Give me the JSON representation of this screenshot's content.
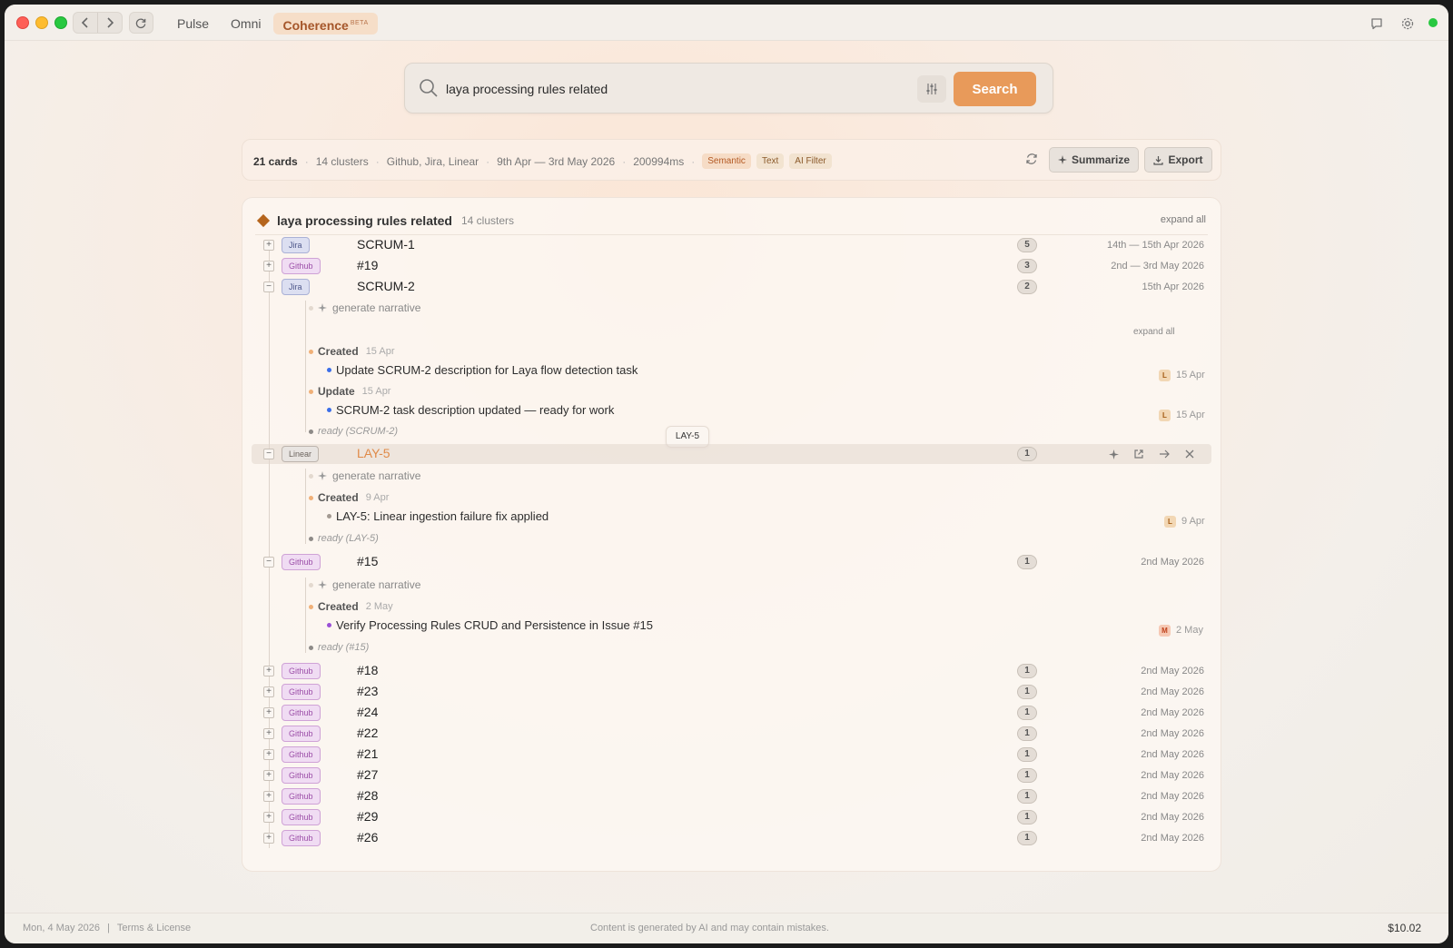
{
  "titlebar": {
    "tabs": [
      {
        "label": "Pulse"
      },
      {
        "label": "Omni"
      },
      {
        "label": "Coherence",
        "badge": "BETA"
      }
    ]
  },
  "search": {
    "value": "laya processing rules related",
    "button_label": "Search"
  },
  "summary": {
    "cards": "21 cards",
    "clusters": "14 clusters",
    "sources": "Github, Jira, Linear",
    "date_range": "9th Apr — 3rd May 2026",
    "duration": "200994ms",
    "modes": [
      "Semantic",
      "Text",
      "AI Filter"
    ],
    "summarize_label": "Summarize",
    "export_label": "Export"
  },
  "results": {
    "query": "laya processing rules related",
    "cluster_count": "14 clusters",
    "expand_all": "expand all",
    "clusters": [
      {
        "source": "Jira",
        "title": "SCRUM-1",
        "count": "5",
        "date": "14th — 15th Apr 2026"
      },
      {
        "source": "Github",
        "title": "#19",
        "count": "3",
        "date": "2nd — 3rd May 2026"
      },
      {
        "source": "Jira",
        "title": "SCRUM-2",
        "count": "2",
        "date": "15th Apr 2026"
      },
      {
        "source": "Linear",
        "title": "LAY-5",
        "count": "1",
        "date": ""
      },
      {
        "source": "Github",
        "title": "#15",
        "count": "1",
        "date": "2nd May 2026"
      },
      {
        "source": "Github",
        "title": "#18",
        "count": "1",
        "date": "2nd May 2026"
      },
      {
        "source": "Github",
        "title": "#23",
        "count": "1",
        "date": "2nd May 2026"
      },
      {
        "source": "Github",
        "title": "#24",
        "count": "1",
        "date": "2nd May 2026"
      },
      {
        "source": "Github",
        "title": "#22",
        "count": "1",
        "date": "2nd May 2026"
      },
      {
        "source": "Github",
        "title": "#21",
        "count": "1",
        "date": "2nd May 2026"
      },
      {
        "source": "Github",
        "title": "#27",
        "count": "1",
        "date": "2nd May 2026"
      },
      {
        "source": "Github",
        "title": "#28",
        "count": "1",
        "date": "2nd May 2026"
      },
      {
        "source": "Github",
        "title": "#29",
        "count": "1",
        "date": "2nd May 2026"
      },
      {
        "source": "Github",
        "title": "#26",
        "count": "1",
        "date": "2nd May 2026"
      }
    ],
    "generate_narrative": "generate narrative",
    "scrum2": {
      "expand_all": "expand all",
      "events": [
        {
          "label": "Created",
          "date": "15 Apr",
          "item": "Update SCRUM-2 description for Laya flow detection task",
          "avatar": "L",
          "item_date": "15 Apr"
        },
        {
          "label": "Update",
          "date": "15 Apr",
          "item": "SCRUM-2 task description updated — ready for work",
          "avatar": "L",
          "item_date": "15 Apr"
        }
      ],
      "ready": "ready (SCRUM-2)"
    },
    "lay5": {
      "tooltip": "LAY-5",
      "events": [
        {
          "label": "Created",
          "date": "9 Apr",
          "item": "LAY-5: Linear ingestion failure fix applied",
          "avatar": "L",
          "item_date": "9 Apr"
        }
      ],
      "ready": "ready (LAY-5)"
    },
    "gh15": {
      "events": [
        {
          "label": "Created",
          "date": "2 May",
          "item": "Verify Processing Rules CRUD and Persistence in Issue #15",
          "avatar": "M",
          "item_date": "2 May"
        }
      ],
      "ready": "ready (#15)"
    }
  },
  "footer": {
    "date": "Mon, 4 May 2026",
    "separator": "|",
    "terms": "Terms & License",
    "disclaimer": "Content is generated by AI and may contain mistakes.",
    "balance": "$10.02"
  },
  "colors": {
    "accent": "#e89a5a",
    "accent_text": "#a5562a",
    "status_online": "#28c840"
  }
}
